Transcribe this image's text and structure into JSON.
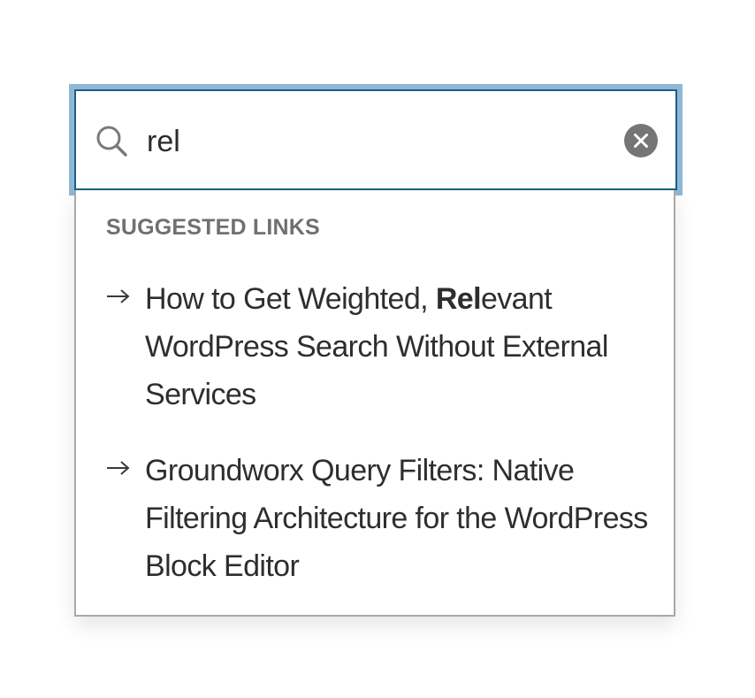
{
  "search": {
    "value": "rel",
    "placeholder": ""
  },
  "icons": {
    "search": "search-icon",
    "clear": "close-icon",
    "arrow": "arrow-right-icon"
  },
  "colors": {
    "focus_ring": "#8fb8d6",
    "input_border": "#1b5f86",
    "clear_button": "#757575",
    "heading": "#707070",
    "text": "#2e2e2e"
  },
  "suggestions": {
    "heading": "SUGGESTED LINKS",
    "items": [
      {
        "before": "How to Get Weighted, ",
        "match": "Rel",
        "after": "evant WordPress Search Without External Services"
      },
      {
        "before": "Groundworx Query Filters: Native Filtering Architecture for the WordPress Block Editor",
        "match": "",
        "after": ""
      }
    ]
  }
}
